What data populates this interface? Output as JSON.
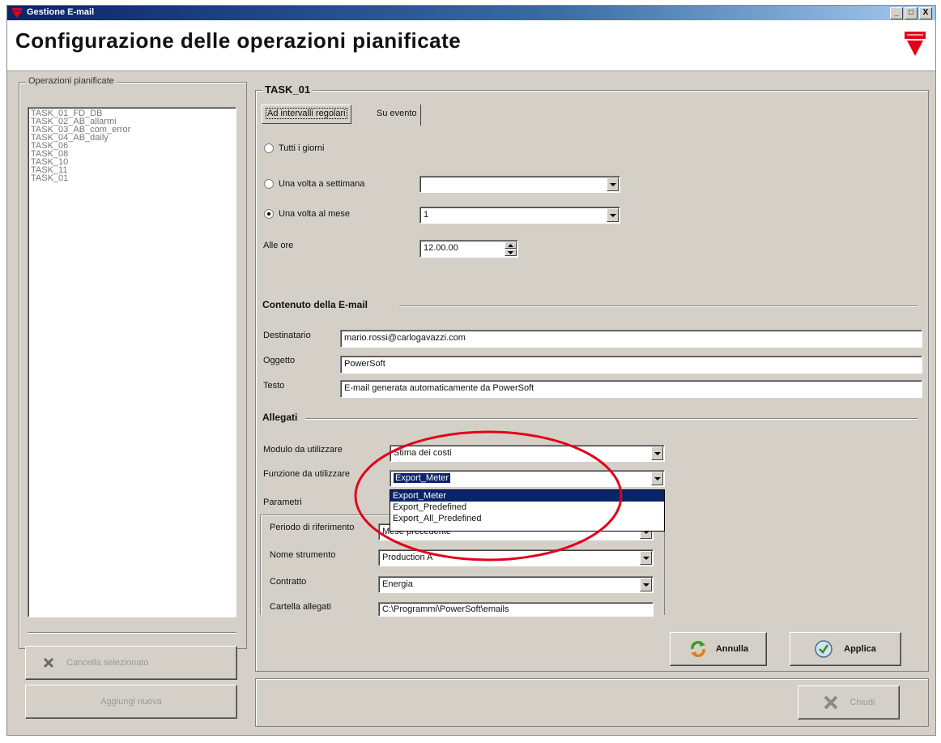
{
  "window": {
    "title": "Gestione E-mail",
    "min": "_",
    "max": "□",
    "close": "X"
  },
  "header": {
    "title": "Configurazione delle operazioni pianificate"
  },
  "left": {
    "legend": "Operazioni pianificate",
    "tasks": [
      "TASK_01_FD_DB",
      "TASK_02_AB_allarmi",
      "TASK_03_AB_com_error",
      "TASK_04_AB_daily",
      "TASK_06",
      "TASK_08",
      "TASK_10",
      "TASK_11",
      "TASK_01"
    ],
    "delete_label": "Cancella selezionato",
    "add_label": "Aggiungi nuova"
  },
  "task": {
    "legend": "TASK_01",
    "tabs": [
      "Ad intervalli regolari",
      "Su evento"
    ],
    "radio_daily": "Tutti i giorni",
    "radio_weekly": "Una volta a settimana",
    "radio_monthly": "Una volta al mese",
    "weekly_value": "",
    "monthly_value": "1",
    "time_label": "Alle ore",
    "time_value": "12.00.00"
  },
  "email": {
    "section": "Contenuto della E-mail",
    "recipient_label": "Destinatario",
    "recipient_value": "mario.rossi@carlogavazzi.com",
    "subject_label": "Oggetto",
    "subject_value": "PowerSoft",
    "text_label": "Testo",
    "text_value": "E-mail generata automaticamente da PowerSoft"
  },
  "attachments": {
    "section": "Allegati",
    "module_label": "Modulo da utilizzare",
    "module_value": "Stima dei costi",
    "function_label": "Funzione da utilizzare",
    "function_value": "Export_Meter",
    "function_options": [
      "Export_Meter",
      "Export_Predefined",
      "Export_All_Predefined"
    ],
    "params_label": "Parametri",
    "period_label": "Periodo di riferimento",
    "period_value": "Mese precedente",
    "instrument_label": "Nome strumento",
    "instrument_value": "Production A",
    "contract_label": "Contratto",
    "contract_value": "Energia",
    "folder_label": "Cartella allegati",
    "folder_value": "C:\\Programmi\\PowerSoft\\emails"
  },
  "actions": {
    "cancel_label": "Annulla",
    "apply_label": "Applica",
    "close_label": "Chiudi"
  },
  "colors": {
    "annotation": "#e3001b",
    "selection": "#0a246a",
    "brand": "#e3001b"
  }
}
